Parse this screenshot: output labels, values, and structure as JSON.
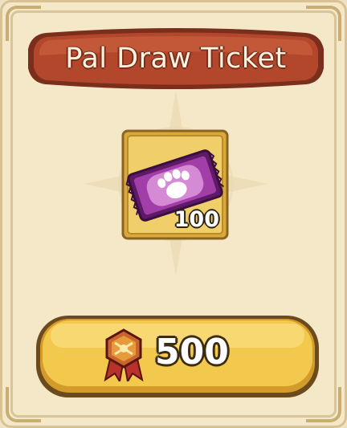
{
  "dialog": {
    "title": "Pal Draw Ticket"
  },
  "item": {
    "icon": "pal-draw-ticket-icon",
    "quantity": "100"
  },
  "purchase": {
    "currency_icon": "medal-currency-icon",
    "price": "500"
  },
  "colors": {
    "banner": "#b3472b",
    "banner_border": "#7a2e1c",
    "button_gold": "#f2c94c",
    "button_border": "#6b4a1e",
    "ticket_purple": "#a23ea8",
    "panel_bg": "#f4e8c8"
  }
}
